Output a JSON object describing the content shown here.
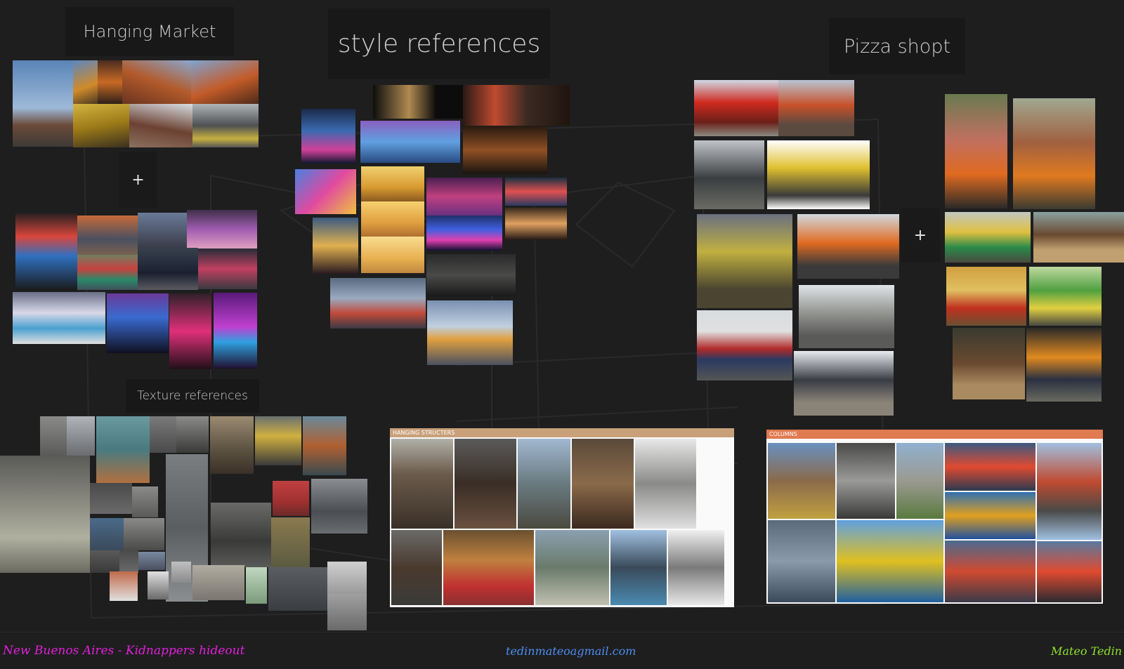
{
  "board": {
    "labels": {
      "hanging_market": "Hanging Market",
      "style_references": "style references",
      "pizza_shop": "Pizza shopt",
      "texture_references": "Texture references"
    },
    "plus_symbol": "+",
    "sheets": {
      "hanging": "HANGING STRUCTERS",
      "columns": "COLUMNS"
    },
    "footer": {
      "title": "New Buenos Aires - Kidnappers hideout",
      "email": "tedinmateoagmail.com",
      "author": "Mateo Tedin"
    }
  },
  "colors": {
    "background": "#1e1e1f",
    "footer_title": "#e020d8",
    "footer_email": "#4d8df0",
    "footer_author": "#8ee02a",
    "sheet_header": "#c8a07a"
  }
}
